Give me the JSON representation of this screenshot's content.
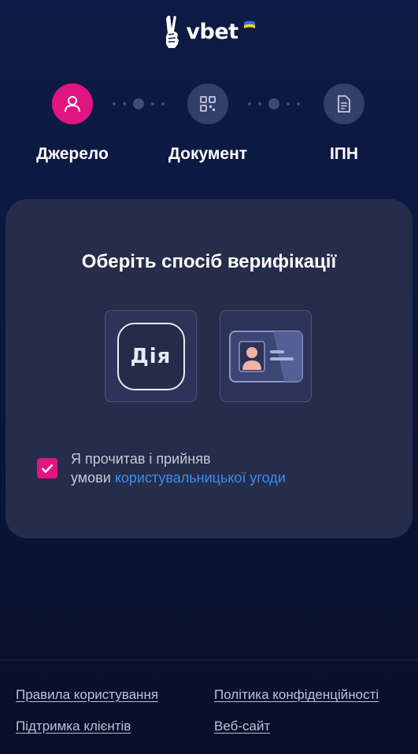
{
  "brand": {
    "name": "vbet"
  },
  "steps": [
    {
      "label": "Джерело",
      "icon": "user-icon",
      "state": "active"
    },
    {
      "label": "Документ",
      "icon": "qr-code-icon",
      "state": "inactive"
    },
    {
      "label": "ІПН",
      "icon": "document-icon",
      "state": "inactive"
    }
  ],
  "verification": {
    "title": "Оберіть спосіб верифікації",
    "options": [
      {
        "name": "diia",
        "text": "Дія",
        "icon": "diia-logo"
      },
      {
        "name": "id-card",
        "icon": "id-card-icon"
      }
    ],
    "agreement": {
      "checked": true,
      "line1": "Я прочитав і прийняв",
      "line2_prefix": "умови ",
      "link_text": "користувальницької угоди"
    }
  },
  "footer": {
    "links": [
      "Правила користування",
      "Політика конфіденційності",
      "Підтримка клієнтів",
      "Веб-сайт"
    ]
  },
  "colors": {
    "accent": "#e0157f",
    "link": "#3a8df0",
    "background": "#0b1840",
    "card": "#252d4a"
  }
}
